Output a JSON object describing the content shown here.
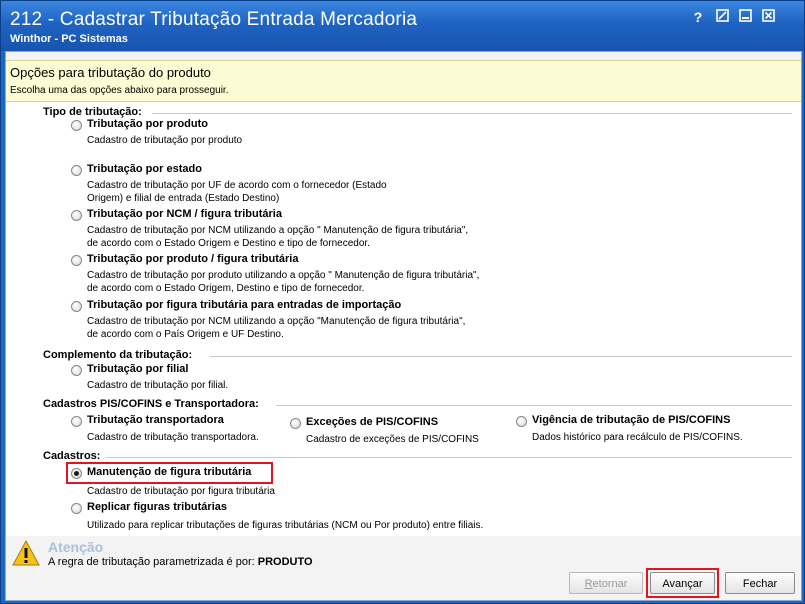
{
  "window": {
    "title": "212 - Cadastrar Tributação Entrada Mercadoria",
    "subtitle": "Winthor - PC Sistemas",
    "controls": [
      "help",
      "maximize",
      "minimize",
      "close"
    ]
  },
  "header": {
    "title": "Opções para tributação do produto",
    "subtitle": "Escolha uma das opções abaixo para prosseguir."
  },
  "groups": {
    "tipo": "Tipo de tributação:",
    "complemento": "Complemento da tributação:",
    "pis": "Cadastros PIS/COFINS e Transportadora:",
    "cadastros": "Cadastros:"
  },
  "options": {
    "por_produto": {
      "label": "Tributação por produto",
      "desc": [
        "Cadastro de tributação por produto"
      ]
    },
    "por_estado": {
      "label": "Tributação por estado",
      "desc": [
        "Cadastro de tributação por UF de acordo com o fornecedor (Estado",
        "Origem) e filial de entrada (Estado Destino)"
      ]
    },
    "por_ncm": {
      "label": "Tributação por NCM / figura tributária",
      "desc": [
        "Cadastro de tributação por NCM utilizando a opção \" Manutenção de figura tributária\",",
        "de acordo com o Estado Origem e Destino e tipo de fornecedor."
      ]
    },
    "por_produto_figura": {
      "label": "Tributação por produto / figura tributária",
      "desc": [
        "Cadastro de tributação por produto utilizando a opção \" Manutenção de figura tributária\",",
        "de acordo com o Estado Origem, Destino e tipo de fornecedor."
      ]
    },
    "importacao": {
      "label": "Tributação por figura tributária para entradas de importação",
      "desc": [
        "Cadastro de tributação por NCM utilizando a opção \"Manutenção de figura tributária\",",
        "de acordo com o País Origem e UF Destino."
      ]
    },
    "por_filial": {
      "label": "Tributação por filial",
      "desc": [
        "Cadastro de tributação por filial."
      ]
    },
    "transportadora": {
      "label": "Tributação  transportadora",
      "desc": [
        "Cadastro de tributação transportadora."
      ]
    },
    "excecoes": {
      "label": "Exceções de PIS/COFINS",
      "desc": [
        "Cadastro de exceções de PIS/COFINS"
      ]
    },
    "vigencia": {
      "label": "Vigência de tributação de PIS/COFINS",
      "desc": [
        "Dados histórico para recálculo de PIS/COFINS."
      ]
    },
    "manutencao": {
      "label": "Manutenção de figura tributária",
      "desc": [
        "Cadastro de tributação por figura tributária"
      ],
      "selected": true
    },
    "replicar": {
      "label": "Replicar figuras tributárias",
      "desc": [
        "Utilizado para replicar tributações de figuras tributárias (NCM ou Por produto) entre filiais."
      ]
    }
  },
  "warning": {
    "title": "Atenção",
    "text": "A regra de tributação parametrizada é por:",
    "value": "PRODUTO"
  },
  "buttons": {
    "retornar": "Retornar",
    "avancar": "Avançar",
    "fechar": "Fechar"
  },
  "colors": {
    "titlebar": "#1f63c2",
    "header_bg": "#fdfbd3",
    "highlight": "#e0151f"
  }
}
